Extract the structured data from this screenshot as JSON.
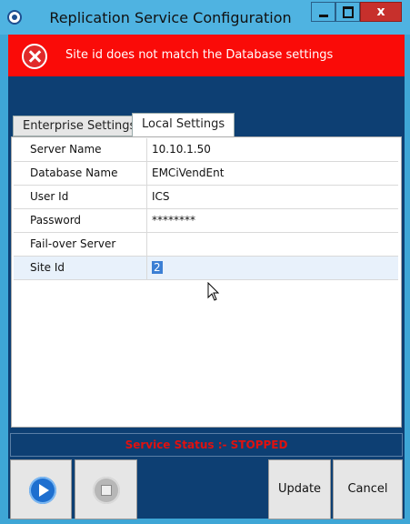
{
  "window": {
    "title": "Replication Service Configuration",
    "close_label": "x"
  },
  "error": {
    "message": "Site id does not match the Database settings"
  },
  "tabs": [
    {
      "label": "Enterprise Settings",
      "selected": false
    },
    {
      "label": "Local Settings",
      "selected": true
    }
  ],
  "settings": [
    {
      "name": "Server Name",
      "value": "10.10.1.50"
    },
    {
      "name": "Database Name",
      "value": "EMCiVendEnt"
    },
    {
      "name": "User Id",
      "value": "ICS"
    },
    {
      "name": "Password",
      "value": "********"
    },
    {
      "name": "Fail-over Server",
      "value": ""
    },
    {
      "name": "Site Id",
      "value": "2"
    }
  ],
  "status": {
    "text": "Service Status :- STOPPED",
    "color": "#e0110f"
  },
  "buttons": {
    "start_icon": "play-icon",
    "stop_icon": "stop-icon",
    "update": "Update",
    "cancel": "Cancel"
  },
  "colors": {
    "banner": "#fa0b08",
    "panel_bg": "#0d3f73",
    "titlebar": "#4fb3e1"
  }
}
